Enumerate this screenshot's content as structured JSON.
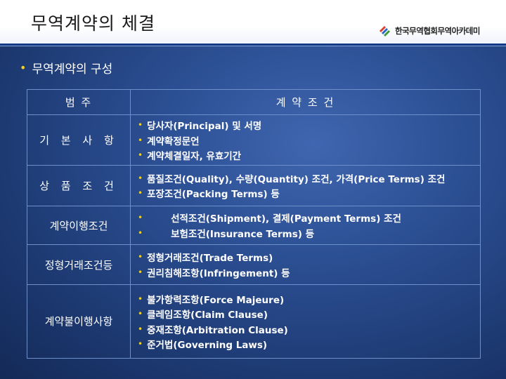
{
  "title": "무역계약의 체결",
  "logo_text": "한국무역협회무역아카데미",
  "subtitle": "무역계약의 구성",
  "table": {
    "headers": [
      "범 주",
      "계 약 조 건"
    ],
    "rows": [
      {
        "category": "기 본 사 항",
        "items": [
          "당사자(Principal) 및 서명",
          "계약확정문언",
          "계약체결일자, 유효기간"
        ]
      },
      {
        "category": "상 품 조 건",
        "items": [
          "품질조건(Quality), 수량(Quantity) 조건, 가격(Price Terms) 조건",
          "포장조건(Packing Terms) 등"
        ]
      },
      {
        "category": "계약이행조건",
        "items": [
          "선적조건(Shipment), 결제(Payment Terms) 조건",
          "보험조건(Insurance Terms) 등"
        ]
      },
      {
        "category": "정형거래조건등",
        "items": [
          "정형거래조건(Trade Terms)",
          "권리침해조항(Infringement) 등"
        ]
      },
      {
        "category": "계약불이행사항",
        "items": [
          "불가항력조항(Force Majeure)",
          "클레임조항(Claim Clause)",
          "중재조항(Arbitration Clause)",
          "준거법(Governing Laws)"
        ]
      }
    ]
  }
}
